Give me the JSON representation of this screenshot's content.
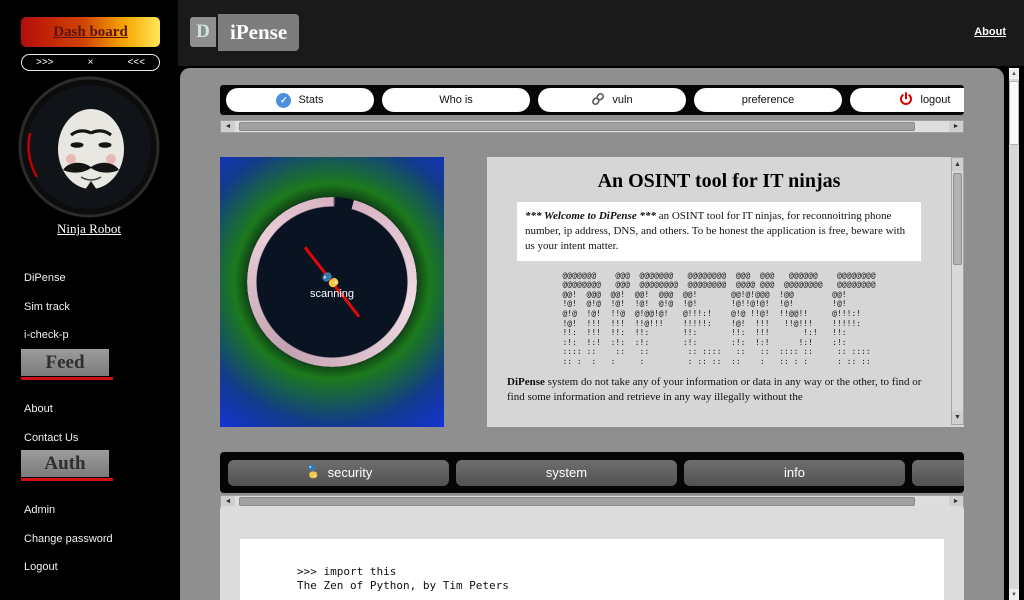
{
  "sidebar": {
    "dashboard": "Dash board",
    "collapse": {
      "left": ">>>",
      "close": "×",
      "right": "<<<"
    },
    "profile_name": "Ninja Robot",
    "links_top": [
      "DiPense",
      "Sim track",
      "i-check-p"
    ],
    "feed": "Feed",
    "links_mid": [
      "About",
      "Contact Us"
    ],
    "auth": "Auth",
    "links_bottom": [
      "Admin",
      "Change password",
      "Logout"
    ]
  },
  "header": {
    "logo_initial": "D",
    "logo_text": "iPense",
    "about": "About"
  },
  "toolbar": {
    "stats": "Stats",
    "whois": "Who is",
    "vuln": "vuln",
    "preference": "preference",
    "logout": "logout"
  },
  "scanner": {
    "status": "scanning"
  },
  "osint": {
    "title": "An OSINT tool for IT ninjas",
    "welcome_lead": "*** Welcome to DiPense ***",
    "welcome_body": " an OSINT tool for IT ninjas, for reconnoitring phone number, ip address, DNS, and others. To be honest the application is free, beware with us your intent matter.",
    "ascii_banner": "@@@@@@@    @@@  @@@@@@@   @@@@@@@@  @@@  @@@   @@@@@@    @@@@@@@@\n@@@@@@@@   @@@  @@@@@@@@  @@@@@@@@  @@@@ @@@  @@@@@@@@   @@@@@@@@\n@@!  @@@  @@!  @@!  @@@  @@!       @@!@!@@@  !@@        @@!\n!@!  @!@  !@!  !@!  @!@  !@!       !@!!@!@!  !@!        !@!\n@!@  !@!  !!@  @!@@!@!   @!!!:!    @!@ !!@!  !!@@!!     @!!!:!\n!@!  !!!  !!!  !!@!!!    !!!!!:    !@!  !!!   !!@!!!    !!!!!:\n!!:  !!!  !!:  !!:       !!:       !!:  !!!       !:!   !!:\n:!:  !:!  :!:  :!:       :!:       :!:  !:!      !:!    :!:\n:::: ::    ::   ::        :: ::::   ::   ::  :::: ::     :: ::::\n:: :  :   :     :         : :: ::  ::    :   :: : :      : :: ::",
    "disclaimer_lead": "DiPense",
    "disclaimer_body": " system do not take any of your information or data in any way or the other, to find or find some information and retrieve in any way illegally without the"
  },
  "tabs": {
    "security": "security",
    "system": "system",
    "info": "info"
  },
  "console": {
    "code": ">>> import this\nThe Zen of Python, by Tim Peters"
  },
  "icons": {
    "verified_check": "✓",
    "up": "▲",
    "down": "▼",
    "left": "◄",
    "right": "►"
  },
  "colors": {
    "accent_red": "#cf1111",
    "badge_blue": "#4a8fe0"
  }
}
